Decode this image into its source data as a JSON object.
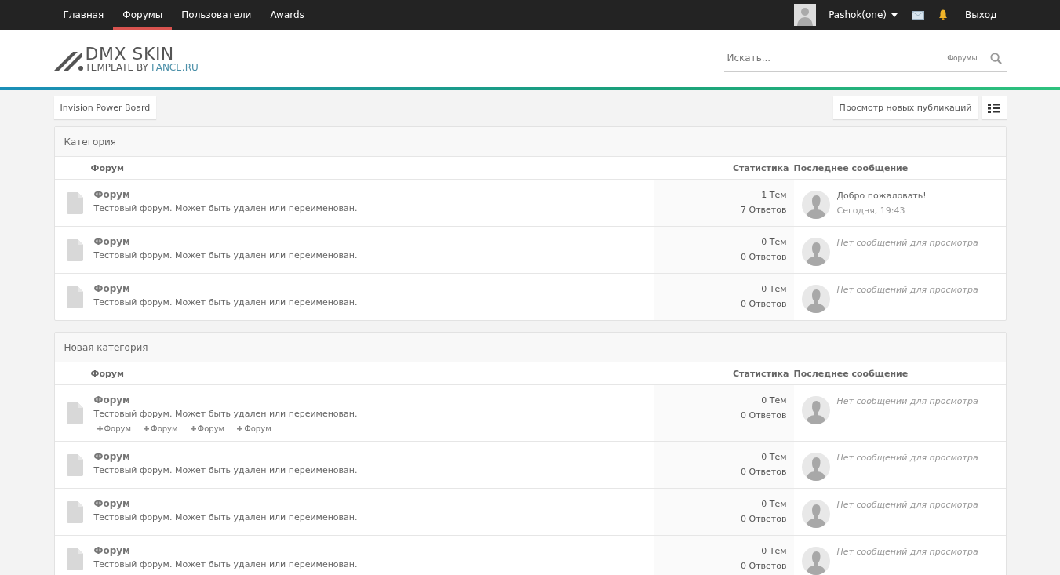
{
  "nav": [
    {
      "label": "Главная",
      "selected": false
    },
    {
      "label": "Форумы",
      "selected": true
    },
    {
      "label": "Пользователи",
      "selected": false
    },
    {
      "label": "Awards",
      "selected": false
    }
  ],
  "user": {
    "name": "Pashok(one)",
    "logout": "Выход"
  },
  "logo": {
    "title": "DMX SKIN",
    "subtitle": "TEMPLATE BY",
    "domain": "FANCE.RU"
  },
  "search": {
    "placeholder": "Искать...",
    "scope": "Форумы"
  },
  "breadcrumb": "Invision Power Board",
  "new_posts": "Просмотр новых публикаций",
  "categories": [
    {
      "title": "Категория",
      "columns": {
        "forum": "Форум",
        "stats": "Статистика",
        "last_post": "Последнее сообщение"
      },
      "forums": [
        {
          "title": "Форум",
          "description": "Тестовый форум. Может быть удален или переименован.",
          "topics": "1 Тем",
          "replies": "7 Ответов",
          "last_post": {
            "kind": "post",
            "title": "Добро пожаловать!",
            "time": "Сегодня, 19:43"
          }
        },
        {
          "title": "Форум",
          "description": "Тестовый форум. Может быть удален или переименован.",
          "topics": "0 Тем",
          "replies": "0 Ответов",
          "last_post": {
            "kind": "none",
            "text": "Нет сообщений для просмотра"
          }
        },
        {
          "title": "Форум",
          "description": "Тестовый форум. Может быть удален или переименован.",
          "topics": "0 Тем",
          "replies": "0 Ответов",
          "last_post": {
            "kind": "none",
            "text": "Нет сообщений для просмотра"
          }
        }
      ]
    },
    {
      "title": "Новая категория",
      "columns": {
        "forum": "Форум",
        "stats": "Статистика",
        "last_post": "Последнее сообщение"
      },
      "forums": [
        {
          "title": "Форум",
          "description": "Тестовый форум. Может быть удален или переименован.",
          "subforums": [
            "Форум",
            "Форум",
            "Форум",
            "Форум"
          ],
          "topics": "0 Тем",
          "replies": "0 Ответов",
          "last_post": {
            "kind": "none",
            "text": "Нет сообщений для просмотра"
          }
        },
        {
          "title": "Форум",
          "description": "Тестовый форум. Может быть удален или переименован.",
          "topics": "0 Тем",
          "replies": "0 Ответов",
          "last_post": {
            "kind": "none",
            "text": "Нет сообщений для просмотра"
          }
        },
        {
          "title": "Форум",
          "description": "Тестовый форум. Может быть удален или переименован.",
          "topics": "0 Тем",
          "replies": "0 Ответов",
          "last_post": {
            "kind": "none",
            "text": "Нет сообщений для просмотра"
          }
        },
        {
          "title": "Форум",
          "description": "Тестовый форум. Может быть удален или переименован.",
          "topics": "0 Тем",
          "replies": "0 Ответов",
          "last_post": {
            "kind": "none",
            "text": "Нет сообщений для просмотра"
          }
        }
      ]
    }
  ]
}
